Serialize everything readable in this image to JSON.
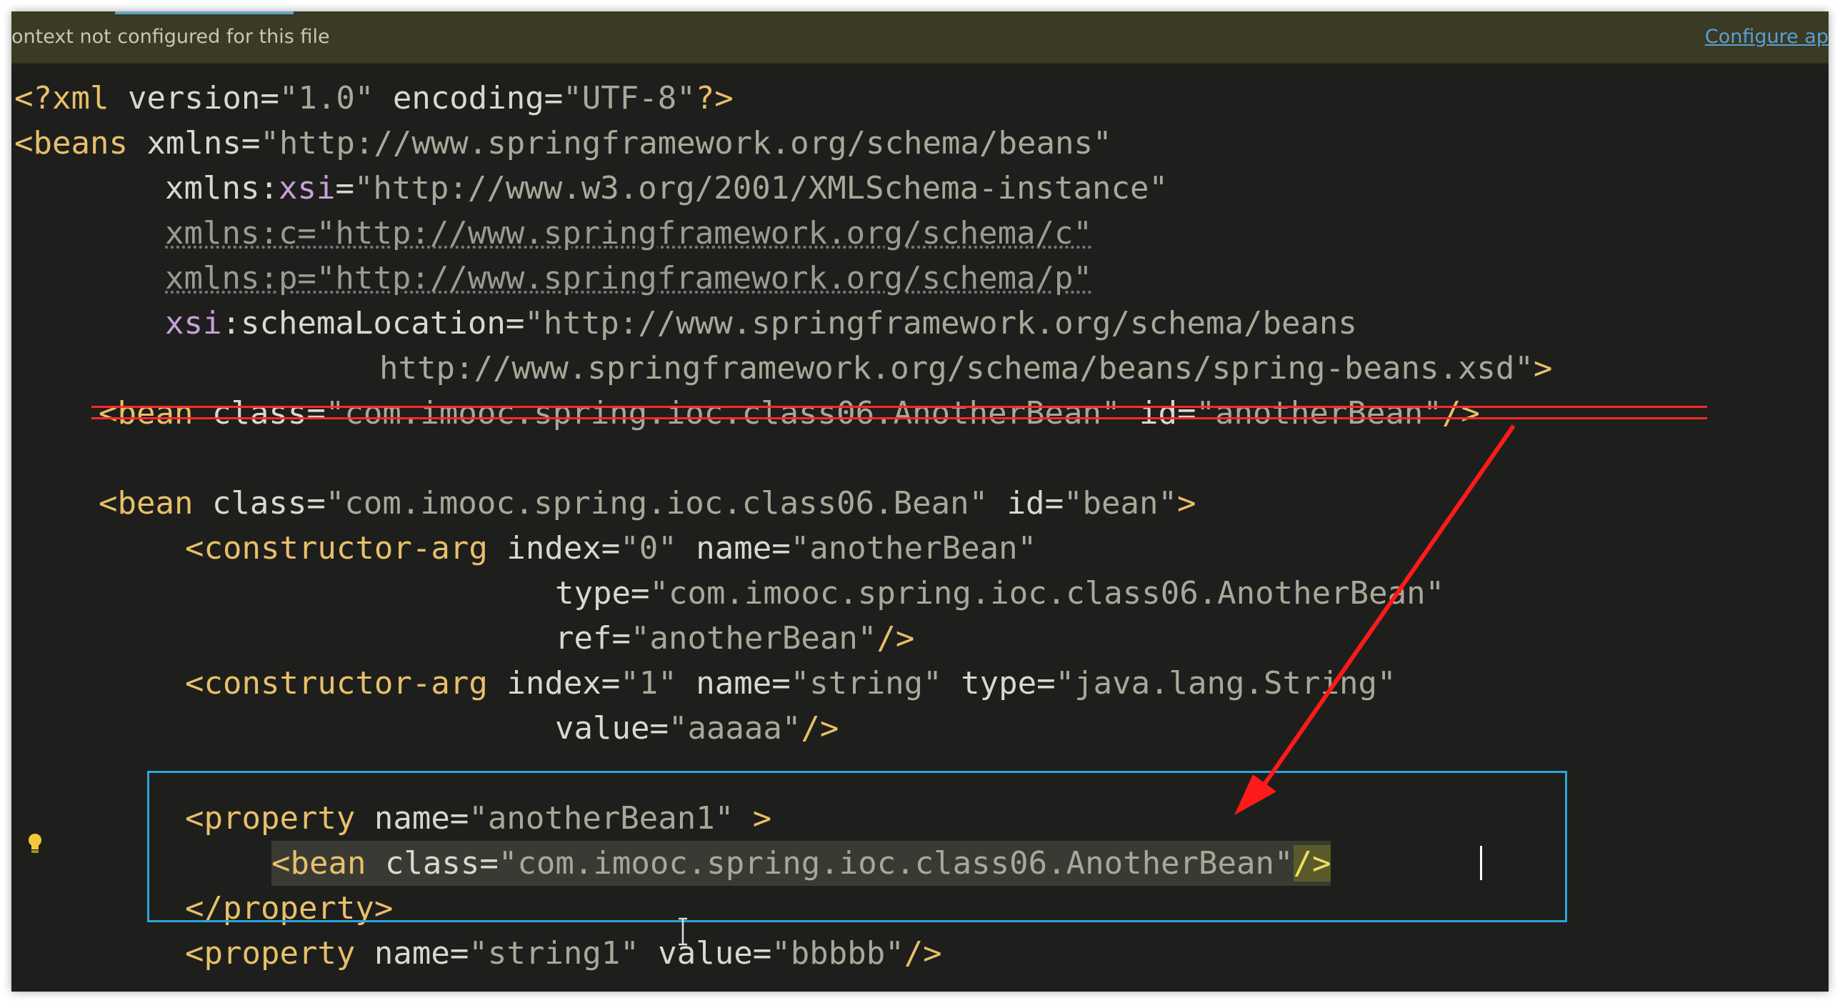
{
  "notification": {
    "text": "ontext not configured for this file",
    "link": "Configure ap"
  },
  "lines": {
    "l1": {
      "p1": "<?xml ",
      "p2": "version",
      "p3": "=",
      "p4": "\"1.0\"",
      "p5": " encoding",
      "p6": "=",
      "p7": "\"UTF-8\"",
      "p8": "?>"
    },
    "l2": {
      "p1": "<beans ",
      "p2": "xmlns",
      "p3": "=",
      "p4": "\"http://www.springframework.org/schema/beans\""
    },
    "l3": {
      "p1": "xmlns:",
      "p2": "xsi",
      "p3": "=",
      "p4": "\"http://www.w3.org/2001/XMLSchema-instance\""
    },
    "l4": {
      "p1": "xmlns:c=\"http://www.springframework.org/schema/c\""
    },
    "l5": {
      "p1": "xmlns:p=\"http://www.springframework.org/schema/p\""
    },
    "l6": {
      "p1": "xsi",
      "p2": ":schemaLocation",
      "p3": "=",
      "p4": "\"http://www.springframework.org/schema/beans"
    },
    "l7": {
      "p1": "http://www.springframework.org/schema/beans/spring-beans.xsd\"",
      "p2": ">"
    },
    "l8": {
      "p1": "<bean ",
      "p2": "class",
      "p3": "=",
      "p4": "\"com.imooc.spring.ioc.class06.AnotherBean\"",
      "p5": " id",
      "p6": "=",
      "p7": "\"anotherBean\"",
      "p8": "/>"
    },
    "l10": {
      "p1": "<bean ",
      "p2": "class",
      "p3": "=",
      "p4": "\"com.imooc.spring.ioc.class06.Bean\"",
      "p5": " id",
      "p6": "=",
      "p7": "\"bean\"",
      "p8": ">"
    },
    "l11": {
      "p1": "<constructor-arg ",
      "p2": "index",
      "p3": "=",
      "p4": "\"0\"",
      "p5": " name",
      "p6": "=",
      "p7": "\"anotherBean\""
    },
    "l12": {
      "p1": "type",
      "p2": "=",
      "p3": "\"com.imooc.spring.ioc.class06.AnotherBean\""
    },
    "l13": {
      "p1": "ref",
      "p2": "=",
      "p3": "\"anotherBean\"",
      "p4": "/>"
    },
    "l14": {
      "p1": "<constructor-arg ",
      "p2": "index",
      "p3": "=",
      "p4": "\"1\"",
      "p5": " name",
      "p6": "=",
      "p7": "\"string\"",
      "p8": " type",
      "p9": "=",
      "p10": "\"java.lang.String\""
    },
    "l15": {
      "p1": "value",
      "p2": "=",
      "p3": "\"aaaaa\"",
      "p4": "/>"
    },
    "l17": {
      "p1": "<property ",
      "p2": "name",
      "p3": "=",
      "p4": "\"anotherBean1\"",
      "p5": " >"
    },
    "l18": {
      "p1": "<bean ",
      "p2": "class",
      "p3": "=",
      "p4": "\"com.imooc.spring.ioc.class06.AnotherBean\"",
      "p5": "/>"
    },
    "l19": {
      "p1": "</property>"
    },
    "l20": {
      "p1": "<property ",
      "p2": "name",
      "p3": "=",
      "p4": "\"string1\"",
      "p5": " value",
      "p6": "=",
      "p7": "\"bbbbb\"",
      "p8": "/>"
    }
  },
  "colors": {
    "editor_bg": "#1e1f1c",
    "tag": "#e8bf6a",
    "string": "#a8a899",
    "annotation_red": "#ff2a2a",
    "highlight_box": "#2fa4d8"
  },
  "icons": {
    "bulb": "lightbulb-icon",
    "arrow": "red-annotation-arrow",
    "ibeam": "text-cursor-icon"
  }
}
